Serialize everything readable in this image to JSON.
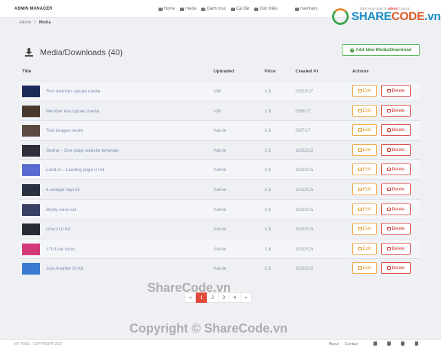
{
  "header": {
    "brand": "ADMIN MANAGER",
    "nav": [
      "Home",
      "media",
      "Danh mục",
      "Cài đặt",
      "Giới thiệu",
      "members"
    ],
    "login_prefix": "Vào trang quản trị",
    "login_user": "admin",
    "logout": "Logout"
  },
  "watermark_logo": {
    "main": "SHARE",
    "accent": "CODE",
    "suffix": ".vn"
  },
  "breadcrumb": {
    "root": "Admin",
    "sep": "/",
    "current": "Media"
  },
  "page": {
    "title": "Media/Downloads (40)",
    "add_button": "Add New Media/Download"
  },
  "table": {
    "columns": [
      "Title",
      "Uploaded",
      "Price",
      "Created At",
      "Actions"
    ],
    "edit_label": "Edit",
    "delete_label": "Delete",
    "rows": [
      {
        "title": "Test member upload media",
        "uploaded": "Việt",
        "price": "1 $",
        "created": "03/23/17",
        "thumb": "#1b2a5a"
      },
      {
        "title": "Member test upload media",
        "uploaded": "Việt",
        "price": "1 $",
        "created": "03/8/17",
        "thumb": "#4a3a2e"
      },
      {
        "title": "Test images resize",
        "uploaded": "Admin",
        "price": "1 $",
        "created": "03/7/17",
        "thumb": "#5a4a40"
      },
      {
        "title": "Sedna – One page website template",
        "uploaded": "Admin",
        "price": "1 $",
        "created": "10/22/15",
        "thumb": "#2e2e3a"
      },
      {
        "title": "Land.io – Landing page UI kit",
        "uploaded": "Admin",
        "price": "1 $",
        "created": "10/22/15",
        "thumb": "#5a6ad0"
      },
      {
        "title": "6 vintage logo kit",
        "uploaded": "Admin",
        "price": "1 $",
        "created": "10/22/15",
        "thumb": "#2a3140"
      },
      {
        "title": "Birply icons set",
        "uploaded": "Admin",
        "price": "1 $",
        "created": "10/22/15",
        "thumb": "#3a3f66"
      },
      {
        "title": "Uzers UI Kit",
        "uploaded": "Admin",
        "price": "1 $",
        "created": "10/22/15",
        "thumb": "#262a33"
      },
      {
        "title": "170 Line Icons",
        "uploaded": "Admin",
        "price": "1 $",
        "created": "10/22/15",
        "thumb": "#d23a7a"
      },
      {
        "title": "Just Another UI Kit",
        "uploaded": "Admin",
        "price": "1 $",
        "created": "10/22/15",
        "thumb": "#3a7ad0"
      }
    ]
  },
  "pagination": {
    "prev": "«",
    "pages": [
      "1",
      "2",
      "3",
      "4"
    ],
    "next": "»",
    "active": "1"
  },
  "watermarks": {
    "line1": "ShareCode.vn",
    "line2": "Copyright © ShareCode.vn"
  },
  "footer": {
    "copyright": "MY PIXEL - COPYRIGHT 2017",
    "links": [
      "About",
      "Contact"
    ]
  }
}
